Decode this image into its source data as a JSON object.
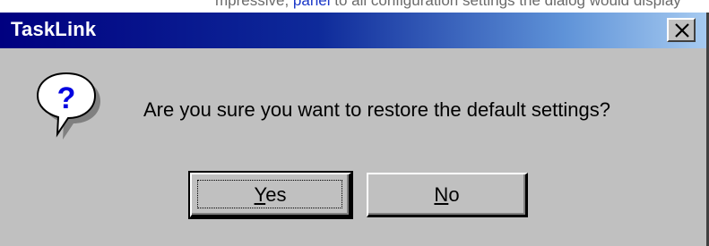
{
  "page_fragment": {
    "before_link": "mpressive, ",
    "link": "panel",
    "after_link": " to all configuration settings the dialog would display"
  },
  "window": {
    "title": "TaskLink",
    "close_icon": "close-x-icon"
  },
  "dialog": {
    "icon": "question-icon",
    "message": "Are you sure you want to restore the default settings?",
    "buttons": [
      {
        "label": "Yes",
        "mnemonic": "Y",
        "rest": "es",
        "default": true
      },
      {
        "label": "No",
        "mnemonic": "N",
        "rest": "o",
        "default": false
      }
    ]
  },
  "colors": {
    "face": "#c0c0c0",
    "titlebar_start": "#000080",
    "titlebar_end": "#a6caf0",
    "icon_blue": "#0000e0"
  }
}
